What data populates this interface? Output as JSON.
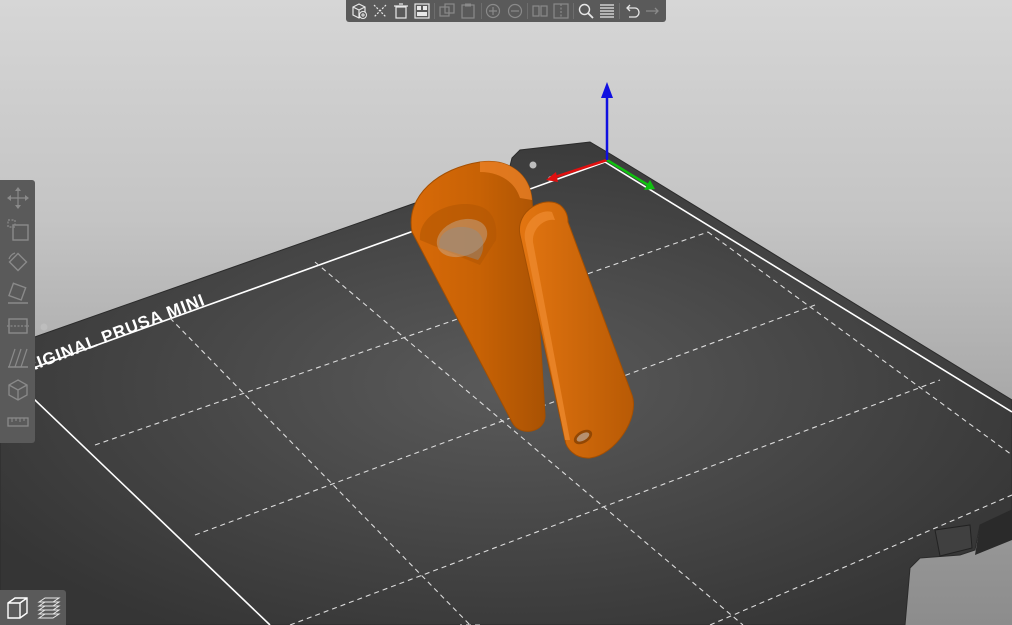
{
  "viewport": {
    "bed_label": "ORIGINAL PRUSA MINI",
    "colors": {
      "bed": "#3c3c3c",
      "bed_outline": "#ffffff",
      "model": "#e0720a",
      "model_shade": "#b85a05",
      "axis_x": "#e01010",
      "axis_y": "#10d010",
      "axis_z": "#1010e0"
    }
  },
  "top_toolbar": {
    "items": [
      "add-icon",
      "delete-icon",
      "delete-all-icon",
      "arrange-icon",
      "copy-icon",
      "paste-icon",
      "add-instance-icon",
      "remove-instance-icon",
      "split-objects-icon",
      "split-parts-icon",
      "search-icon",
      "layers-editing-icon",
      "undo-icon",
      "redo-icon"
    ]
  },
  "left_toolbar": {
    "items": [
      "move-icon",
      "scale-icon",
      "rotate-icon",
      "place-on-face-icon",
      "cut-icon",
      "paint-supports-icon",
      "seam-painting-icon",
      "measure-icon"
    ]
  },
  "view_toggle": {
    "items": [
      "3d-view-icon",
      "preview-icon"
    ]
  }
}
